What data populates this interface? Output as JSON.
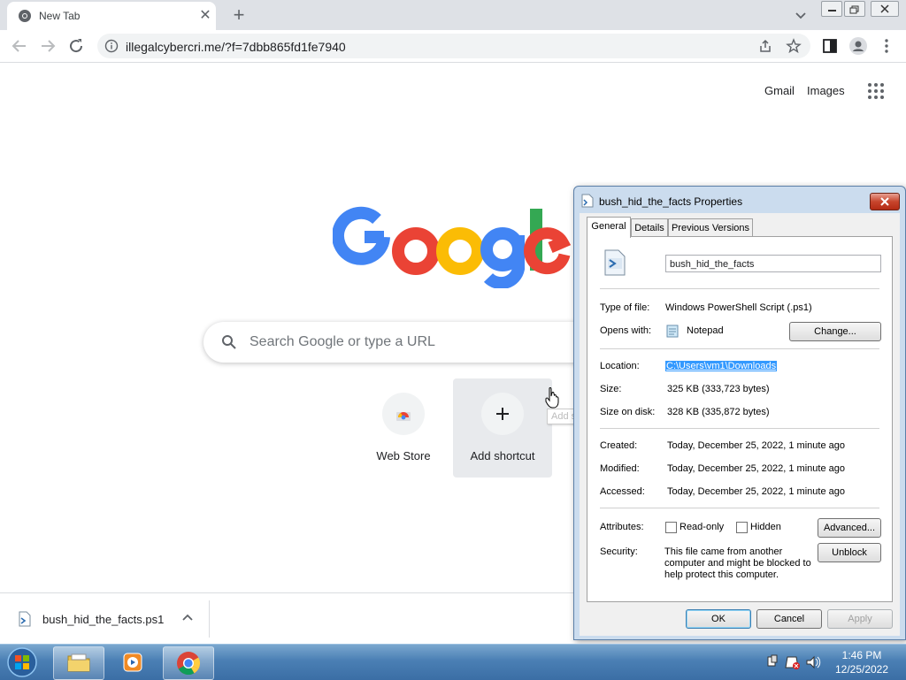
{
  "browser": {
    "tab_title": "New Tab",
    "url": "illegalcybercri.me/?f=7dbb865fd1fe7940"
  },
  "ntp": {
    "gmail": "Gmail",
    "images": "Images",
    "search_placeholder": "Search Google or type a URL",
    "shortcuts": [
      {
        "label": "Web Store"
      },
      {
        "label": "Add shortcut"
      }
    ],
    "tooltip": "Add shortcut"
  },
  "download": {
    "filename": "bush_hid_the_facts.ps1"
  },
  "dialog": {
    "title": "bush_hid_the_facts Properties",
    "tabs": [
      "General",
      "Details",
      "Previous Versions"
    ],
    "file_name": "bush_hid_the_facts",
    "type_label": "Type of file:",
    "type_value": "Windows PowerShell Script (.ps1)",
    "opens_label": "Opens with:",
    "opens_value": "Notepad",
    "change_btn": "Change...",
    "location_label": "Location:",
    "location_value": "C:\\Users\\vm1\\Downloads",
    "size_label": "Size:",
    "size_value": "325 KB (333,723 bytes)",
    "disk_label": "Size on disk:",
    "disk_value": "328 KB (335,872 bytes)",
    "created_label": "Created:",
    "created_value": "Today, December 25, 2022, 1 minute ago",
    "modified_label": "Modified:",
    "modified_value": "Today, December 25, 2022, 1 minute ago",
    "accessed_label": "Accessed:",
    "accessed_value": "Today, December 25, 2022, 1 minute ago",
    "attributes_label": "Attributes:",
    "readonly_label": "Read-only",
    "hidden_label": "Hidden",
    "advanced_btn": "Advanced...",
    "security_label": "Security:",
    "security_text": "This file came from another computer and might be blocked to help protect this computer.",
    "unblock_btn": "Unblock",
    "ok_btn": "OK",
    "cancel_btn": "Cancel",
    "apply_btn": "Apply"
  },
  "taskbar": {
    "time": "1:46 PM",
    "date": "12/25/2022"
  },
  "icons": [
    "chrome-favicon",
    "close-icon",
    "plus-icon",
    "back-arrow-icon",
    "forward-arrow-icon",
    "reload-icon",
    "info-icon",
    "share-icon",
    "star-icon",
    "side-panel-icon",
    "profile-icon",
    "more-vert-icon",
    "apps-grid-icon",
    "search-icon",
    "powershell-file-icon",
    "notepad-icon",
    "windows-start-orb"
  ]
}
